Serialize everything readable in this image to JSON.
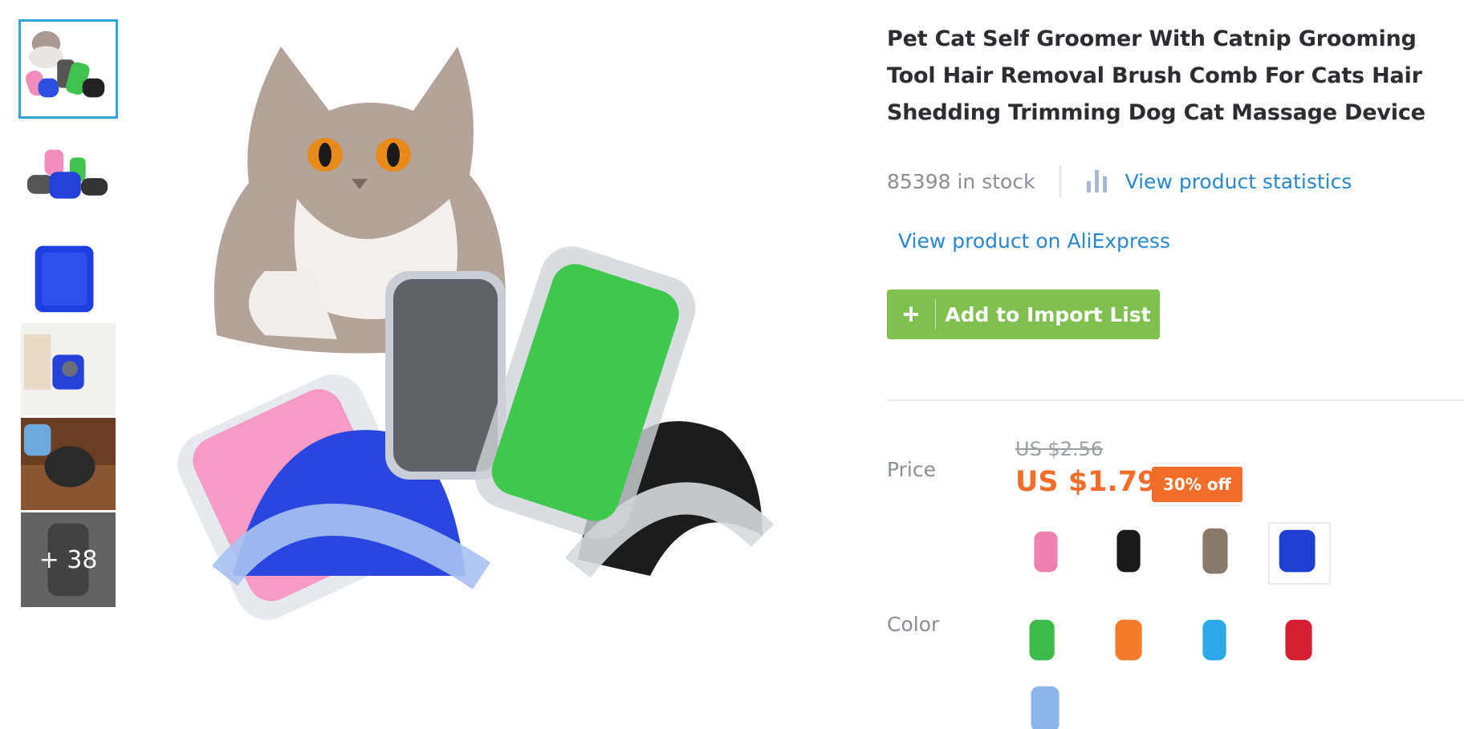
{
  "gallery": {
    "thumbnails": [
      {
        "name": "thumb-cat-with-groomers",
        "active": true
      },
      {
        "name": "thumb-groomers-set",
        "active": false
      },
      {
        "name": "thumb-blue-groomer",
        "active": false
      },
      {
        "name": "thumb-groomer-on-wall",
        "active": false
      },
      {
        "name": "thumb-cat-using-groomer",
        "active": false
      },
      {
        "name": "thumb-black-groomer",
        "active": false
      }
    ],
    "more_count": "+ 38"
  },
  "product": {
    "title": "Pet Cat Self Groomer With Catnip Grooming Tool Hair Removal Brush Comb For Cats Hair Shedding Trimming Dog Cat Massage Device",
    "stock_text": "85398 in stock",
    "stats_link": "View product statistics",
    "stats_icon": "bar-chart-icon",
    "aliexpress_link": "View product on AliExpress",
    "add_button": "Add to Import List",
    "add_icon": "plus-icon"
  },
  "price": {
    "label": "Price",
    "original": "US $2.56",
    "current": "US $1.79",
    "discount": "30% off"
  },
  "color": {
    "label": "Color",
    "options": [
      {
        "name": "pink",
        "hex": "#f080b0",
        "selected": false
      },
      {
        "name": "black",
        "hex": "#1a1a1a",
        "selected": false
      },
      {
        "name": "brown",
        "hex": "#8a7868",
        "selected": false
      },
      {
        "name": "blue",
        "hex": "#1e3fd0",
        "selected": true
      },
      {
        "name": "green",
        "hex": "#3cba4a",
        "selected": false
      },
      {
        "name": "orange",
        "hex": "#f57a2a",
        "selected": false
      },
      {
        "name": "light-blue",
        "hex": "#2aa8e8",
        "selected": false
      },
      {
        "name": "red",
        "hex": "#d4202e",
        "selected": false
      },
      {
        "name": "pale-blue",
        "hex": "#8ab4ea",
        "selected": false
      }
    ]
  },
  "colors": {
    "accent_blue": "#2787d4",
    "button_green": "#7fc04f",
    "price_orange": "#f36d2a",
    "active_thumb_border": "#34a3d8"
  }
}
